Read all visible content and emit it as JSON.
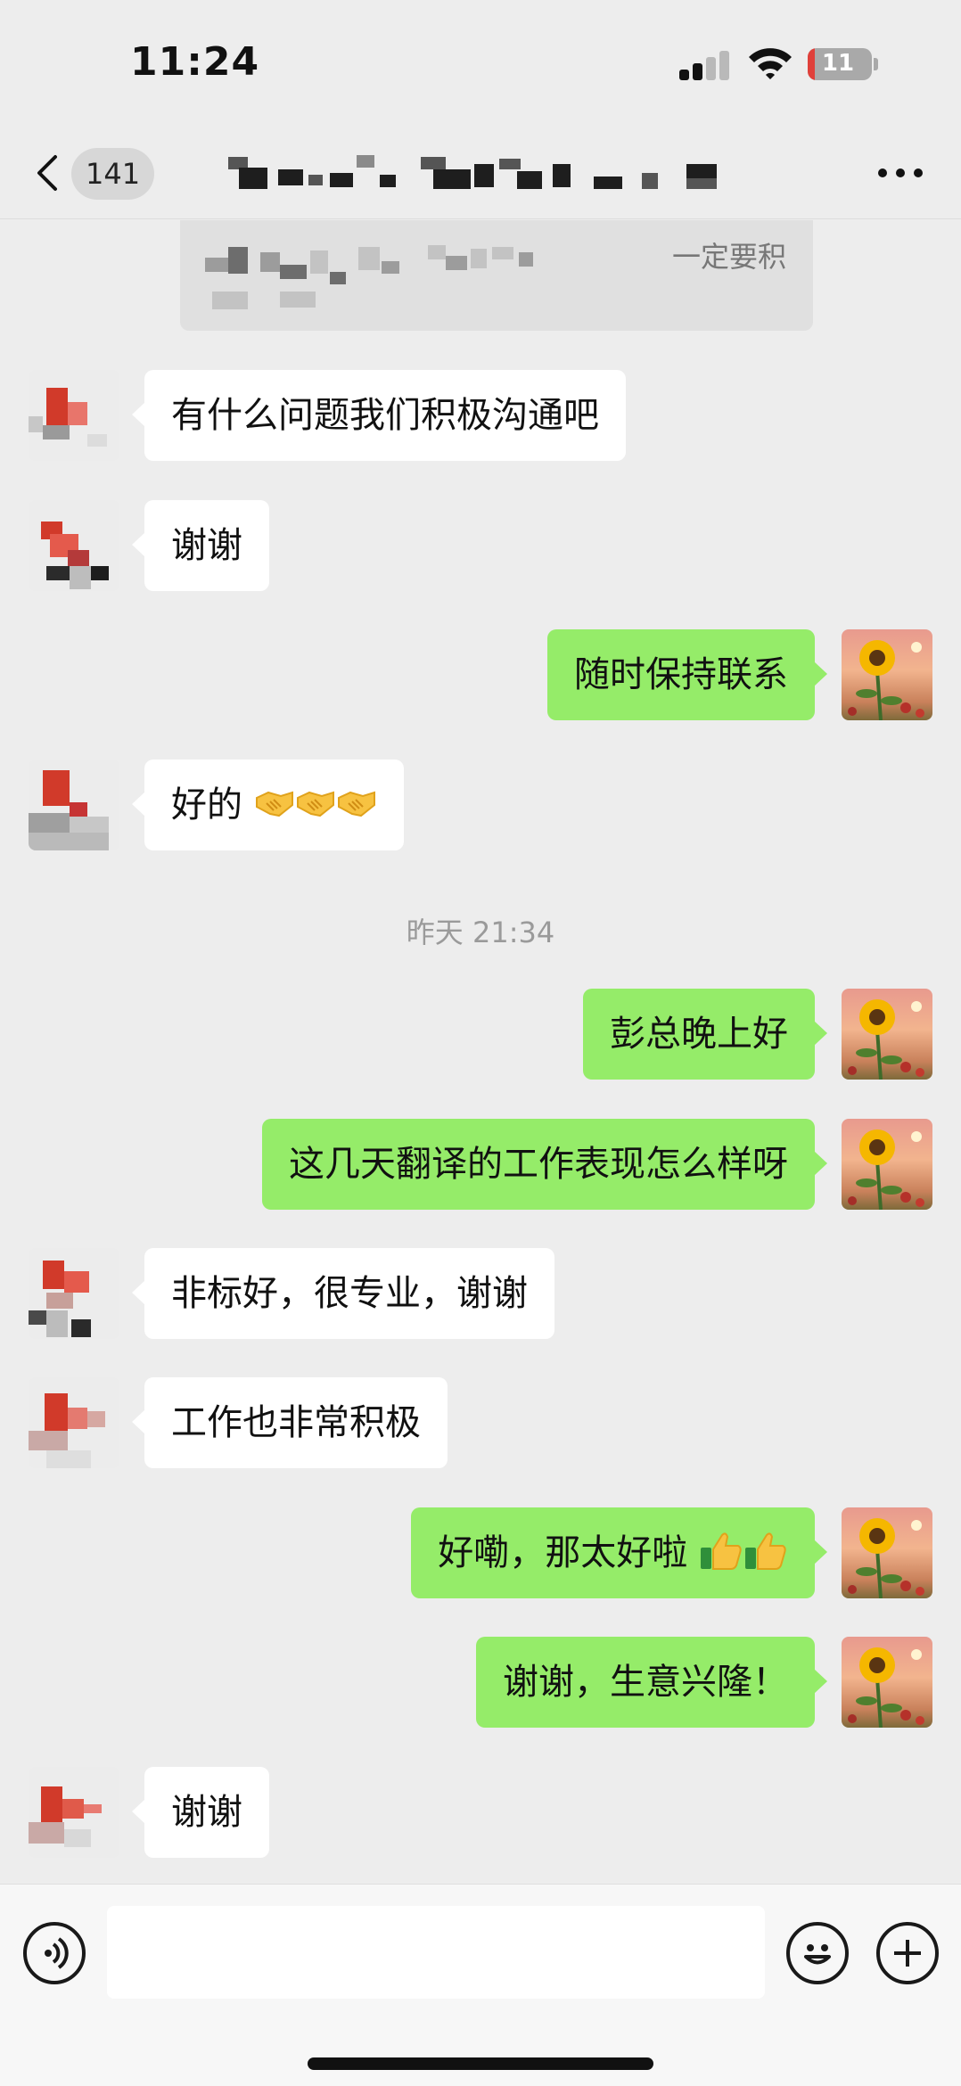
{
  "status_bar": {
    "time": "11:24",
    "battery_text": "11",
    "battery_level_percent": 11,
    "battery_color": "#e0403a",
    "icons": [
      "signal-icon",
      "wifi-icon",
      "battery-icon"
    ]
  },
  "nav": {
    "unread_count": "141",
    "title": "",
    "back_icon": "chevron-left-icon",
    "more_icon": "more-dots-icon"
  },
  "quote": {
    "visible_tail": "一定要积"
  },
  "colors": {
    "background": "#ededed",
    "incoming_bubble": "#ffffff",
    "outgoing_bubble": "#95ec69",
    "timestamp": "#9a9a9a"
  },
  "messages": [
    {
      "side": "left",
      "text": "有什么问题我们积极沟通吧"
    },
    {
      "side": "left",
      "text": "谢谢"
    },
    {
      "side": "right",
      "text": "随时保持联系"
    },
    {
      "side": "left",
      "text": "好的",
      "emoji": [
        "handshake-icon",
        "handshake-icon",
        "handshake-icon"
      ]
    },
    {
      "side": "right",
      "text": "彭总晚上好"
    },
    {
      "side": "right",
      "text": "这几天翻译的工作表现怎么样呀"
    },
    {
      "side": "left",
      "text": "非标好，很专业，谢谢"
    },
    {
      "side": "left",
      "text": "工作也非常积极"
    },
    {
      "side": "right",
      "text": "好嘞，那太好啦",
      "emoji": [
        "thumbs-up-icon",
        "thumbs-up-icon"
      ]
    },
    {
      "side": "right",
      "text": "谢谢，生意兴隆！"
    },
    {
      "side": "left",
      "text": "谢谢"
    }
  ],
  "timestamp": "昨天 21:34",
  "input_bar": {
    "placeholder": "",
    "icons": [
      "voice-icon",
      "emoji-face-icon",
      "plus-icon"
    ]
  }
}
